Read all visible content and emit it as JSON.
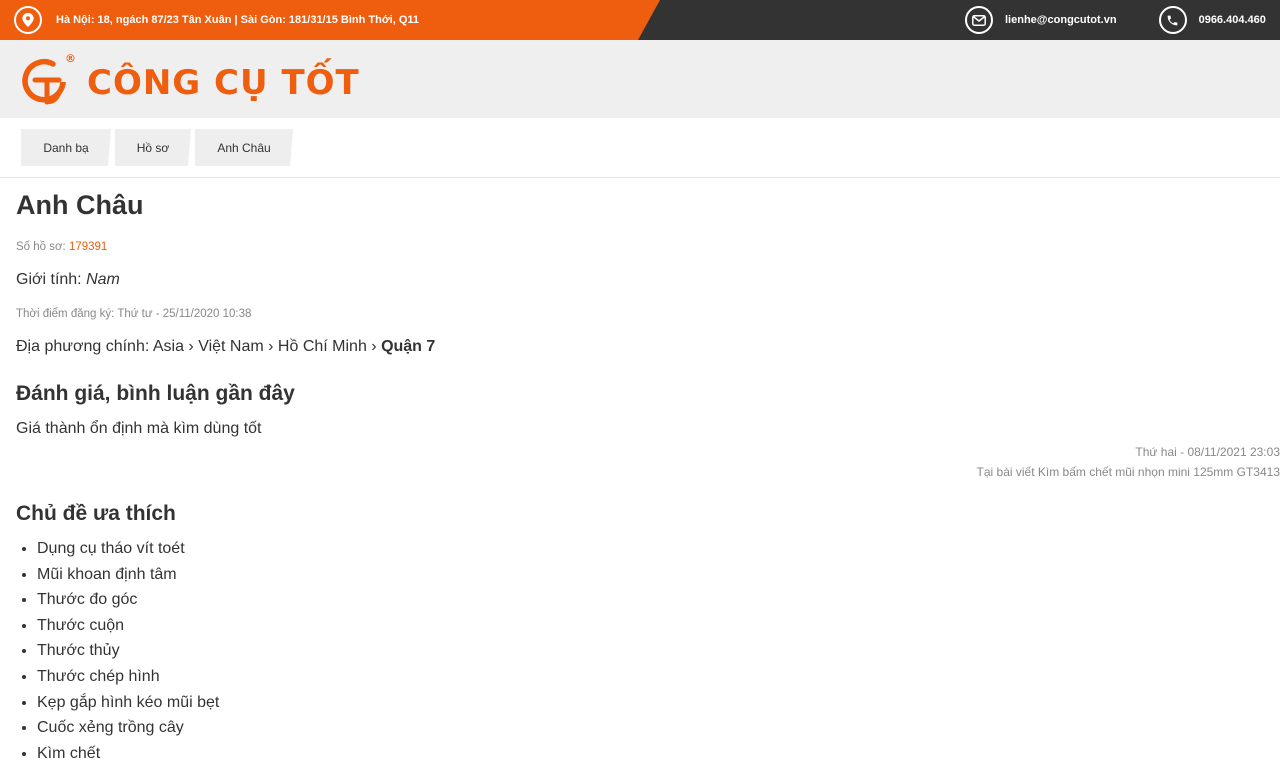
{
  "topbar": {
    "address": "Hà Nội: 18, ngách 87/23 Tân Xuân | Sài Gòn: 181/31/15 Bình Thới, Q11",
    "email": "lienhe@congcutot.vn",
    "phone": "0966.404.460"
  },
  "brand": {
    "name": "CÔNG CỤ TỐT",
    "color": "#ef5d0e",
    "registered_mark": "®"
  },
  "breadcrumb": [
    "Danh bạ",
    "Hồ sơ",
    "Anh Châu"
  ],
  "profile": {
    "name": "Anh Châu",
    "id_label": "Số hồ sơ:",
    "id_value": "179391",
    "gender_label": "Giới tính:",
    "gender_value": "Nam",
    "registered_label": "Thời điểm đăng ký:",
    "registered_value": "Thứ tư - 25/11/2020 10:38",
    "location_label": "Địa phương chính:",
    "location_path": "Asia › Việt Nam › Hồ Chí Minh ›",
    "location_last": "Quận 7"
  },
  "reviews": {
    "title": "Đánh giá, bình luận gần đây",
    "items": [
      {
        "text": "Giá thành ổn định mà kìm dùng tốt",
        "date": "Thứ hai - 08/11/2021 23:03",
        "source": "Tại bài viết Kìm bấm chết mũi nhọn mini 125mm GT3413"
      }
    ]
  },
  "topics": {
    "title": "Chủ đề ưa thích",
    "items": [
      "Dụng cụ tháo vít toét",
      "Mũi khoan định tâm",
      "Thước đo góc",
      "Thước cuộn",
      "Thước thủy",
      "Thước chép hình",
      "Kẹp gắp hình kéo mũi bẹt",
      "Cuốc xẻng trồng cây",
      "Kìm chết"
    ]
  }
}
